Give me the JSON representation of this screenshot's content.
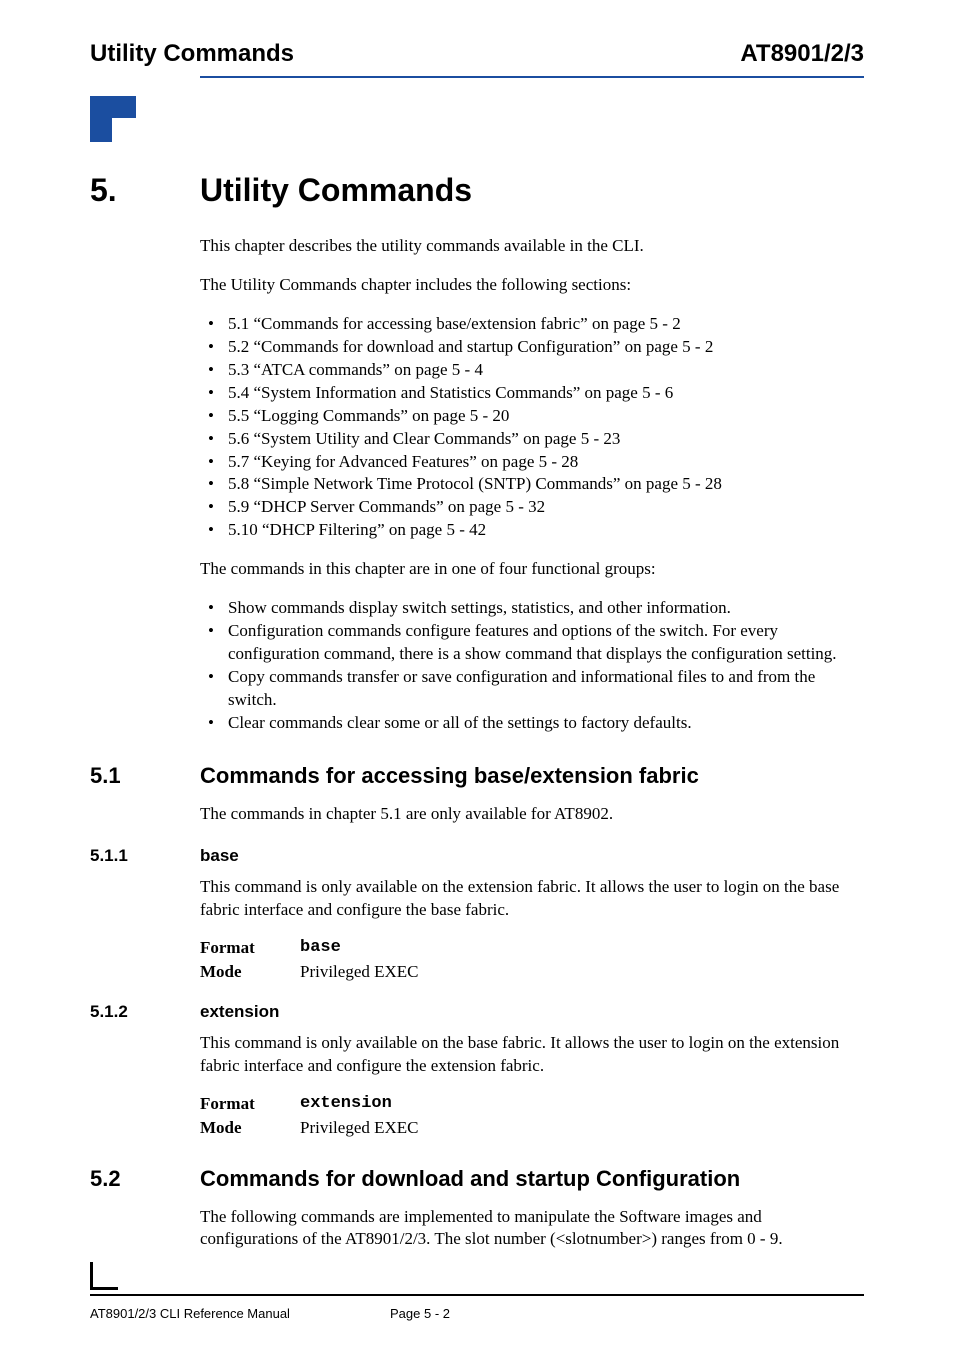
{
  "header": {
    "left": "Utility Commands",
    "right": "AT8901/2/3"
  },
  "chapter": {
    "number": "5.",
    "title": "Utility Commands"
  },
  "intro1": "This chapter describes the utility commands available in the CLI.",
  "intro2": "The Utility Commands chapter includes the following sections:",
  "toc": [
    "5.1 “Commands for accessing base/extension fabric”  on page 5 - 2",
    "5.2 “Commands for download and startup Configuration”  on page 5 - 2",
    "5.3 “ATCA commands”  on page 5 - 4",
    "5.4 “System Information and Statistics Commands”  on page 5 - 6",
    "5.5 “Logging Commands”  on page 5 - 20",
    "5.6 “System Utility and Clear Commands”  on page 5 - 23",
    "5.7 “Keying for Advanced Features”  on page 5 - 28",
    "5.8 “Simple Network Time Protocol (SNTP) Commands”  on page 5 - 28",
    "5.9 “DHCP Server Commands”  on page 5 - 32",
    "5.10 “DHCP Filtering”  on page 5 - 42"
  ],
  "groups_intro": "The commands in this chapter are in one of four functional groups:",
  "groups": [
    "Show commands display switch settings, statistics, and other information.",
    "Configuration commands configure features and options of the switch. For every configuration command, there is a show command that displays the configuration setting.",
    "Copy commands transfer or save configuration and informational files to and from the switch.",
    "Clear commands clear some or all of the settings to factory defaults."
  ],
  "sec51": {
    "num": "5.1",
    "title": "Commands for accessing base/extension fabric",
    "intro": "The commands in chapter 5.1 are only available for AT8902."
  },
  "sec511": {
    "num": "5.1.1",
    "title": "base",
    "desc": "This command is only available on the extension fabric. It allows the user to login on the base fabric interface and configure the base fabric.",
    "format_label": "Format",
    "format_value": "base",
    "mode_label": "Mode",
    "mode_value": "Privileged EXEC"
  },
  "sec512": {
    "num": "5.1.2",
    "title": "extension",
    "desc": "This command is only available on the base fabric. It allows the user to login on the extension fabric interface and configure the extension fabric.",
    "format_label": "Format",
    "format_value": "extension",
    "mode_label": "Mode",
    "mode_value": "Privileged EXEC"
  },
  "sec52": {
    "num": "5.2",
    "title": "Commands for download and startup Configuration",
    "intro": "The following commands are implemented to manipulate the Software images and configurations of the AT8901/2/3. The slot number  (<slotnumber>) ranges from 0 - 9."
  },
  "footer": {
    "left": "AT8901/2/3 CLI Reference Manual",
    "page": "Page 5 - 2"
  }
}
